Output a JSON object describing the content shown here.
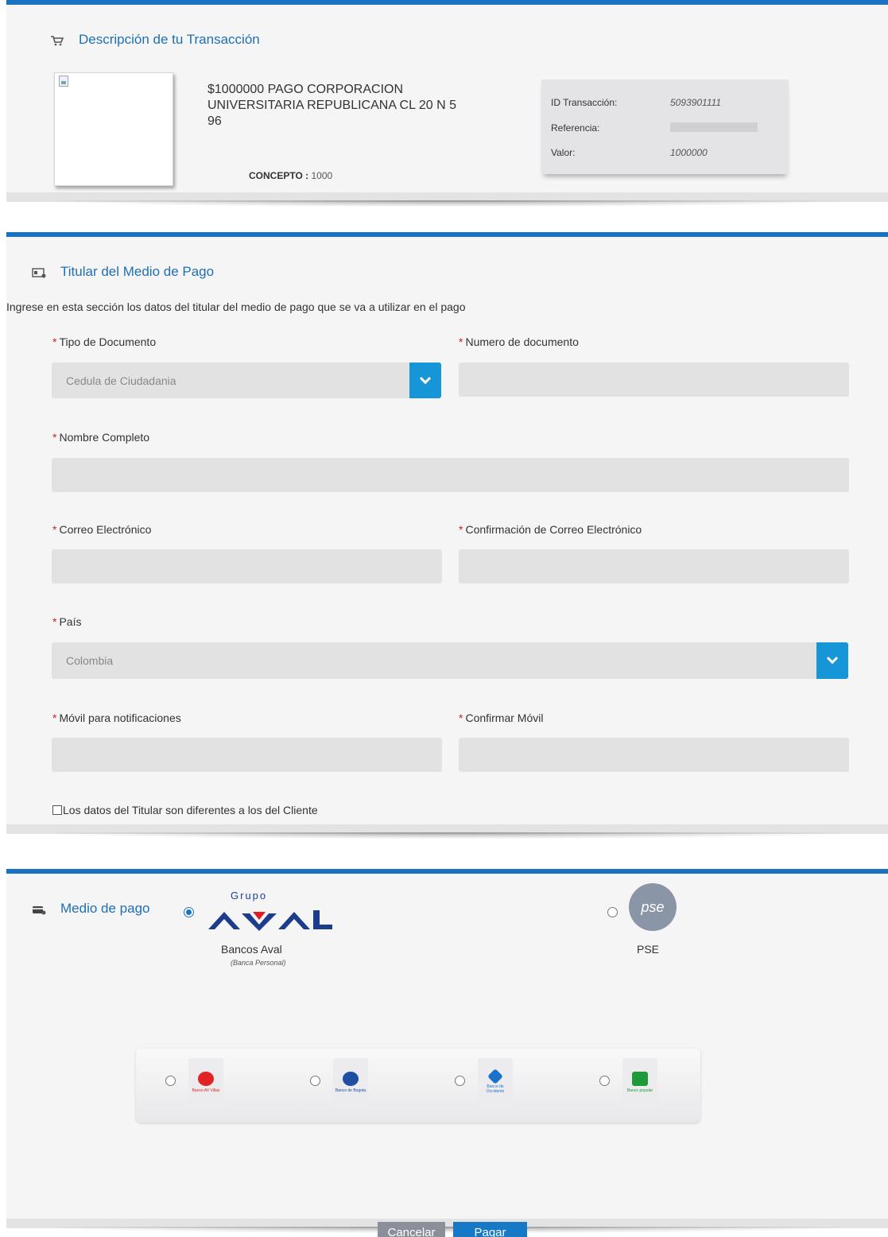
{
  "transaction": {
    "title": "Descripción de tu Transacción",
    "description": "$1000000 PAGO CORPORACION UNIVERSITARIA REPUBLICANA CL 20 N 5 96",
    "concept_label": "CONCEPTO :",
    "concept_value": "1000",
    "id_label": "ID Transacción:",
    "id_value": "5093901111",
    "reference_label": "Referencia:",
    "value_label": "Valor:",
    "value_value": "1000000"
  },
  "holder": {
    "title": "Titular del Medio de Pago",
    "intro": "Ingrese en esta sección los datos del titular del medio de pago que se va a utilizar en el pago",
    "required_mark": "*",
    "doc_type_label": "Tipo de Documento",
    "doc_type_value": "Cedula de Ciudadania",
    "doc_number_label": "Numero de documento",
    "full_name_label": "Nombre Completo",
    "email_label": "Correo Electrónico",
    "email_confirm_label": "Confirmación de Correo Electrónico",
    "country_label": "País",
    "country_value": "Colombia",
    "mobile_label": "Móvil para notificaciones",
    "mobile_confirm_label": "Confirmar Móvil",
    "different_holder_label": "Los datos del Titular son diferentes a los del Cliente"
  },
  "payment": {
    "title": "Medio de pago",
    "aval_group_text": "Grupo",
    "aval_caption": "Bancos Aval",
    "aval_sub": "(Banca Personal)",
    "pse_logo_text": "pse",
    "pse_caption": "PSE",
    "banks": [
      {
        "name": "Banco AV Villas",
        "color": "#e02424"
      },
      {
        "name": "Banco de Bogota",
        "color": "#1e4fa0"
      },
      {
        "name": "Banco de Occidente",
        "color": "#1a73c9"
      },
      {
        "name": "Banco popular",
        "color": "#1e9a3a"
      }
    ]
  },
  "actions": {
    "cancel": "Cancelar",
    "pay": "Pagar"
  },
  "colors": {
    "accent": "#1a72c2",
    "select_button": "#1796d7",
    "required": "#d21f1f"
  }
}
